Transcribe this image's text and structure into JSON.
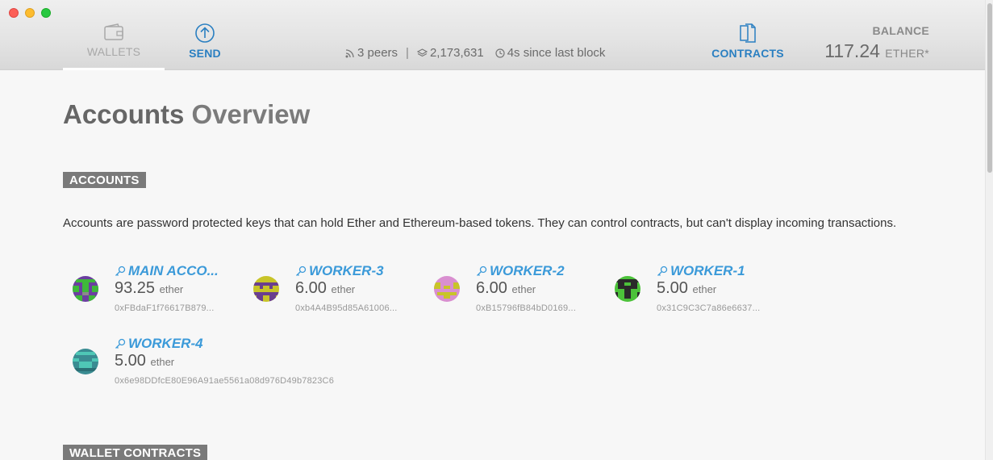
{
  "window": {
    "controls": [
      "close",
      "minimize",
      "zoom"
    ]
  },
  "nav": {
    "wallets": {
      "label": "WALLETS",
      "icon": "wallet-icon",
      "active": true
    },
    "send": {
      "label": "SEND",
      "icon": "arrow-up-circle-icon"
    },
    "contracts": {
      "label": "CONTRACTS",
      "icon": "documents-icon"
    }
  },
  "status": {
    "peers": "3 peers",
    "separator": "|",
    "block": "2,173,631",
    "since_last_block": "4s since last block"
  },
  "balance": {
    "label": "BALANCE",
    "value": "117.24",
    "unit": "ETHER*"
  },
  "page": {
    "title_strong": "Accounts",
    "title_light": "Overview"
  },
  "accounts_section": {
    "header": "ACCOUNTS",
    "description": "Accounts are password protected keys that can hold Ether and Ethereum-based tokens. They can control contracts, but can't display incoming transactions.",
    "items": [
      {
        "name": "MAIN ACCO...",
        "amount": "93.25",
        "unit": "ether",
        "address": "0xFBdaF1f76617B879...",
        "icon": "key-icon"
      },
      {
        "name": "WORKER-3",
        "amount": "6.00",
        "unit": "ether",
        "address": "0xb4A4B95d85A61006...",
        "icon": "key-icon"
      },
      {
        "name": "WORKER-2",
        "amount": "6.00",
        "unit": "ether",
        "address": "0xB15796fB84bD0169...",
        "icon": "key-icon"
      },
      {
        "name": "WORKER-1",
        "amount": "5.00",
        "unit": "ether",
        "address": "0x31C9C3C7a86e6637...",
        "icon": "key-icon"
      },
      {
        "name": "WORKER-4",
        "amount": "5.00",
        "unit": "ether",
        "address": "0x6e98DDfcE80E96A91ae5561a08d976D49b7823C6",
        "icon": "key-icon"
      }
    ]
  },
  "wallet_contracts_section": {
    "header": "WALLET CONTRACTS"
  },
  "colors": {
    "accent": "#3b9ad9",
    "nav_blue": "#2a7fc1",
    "section_bg": "#7a7a7a"
  }
}
